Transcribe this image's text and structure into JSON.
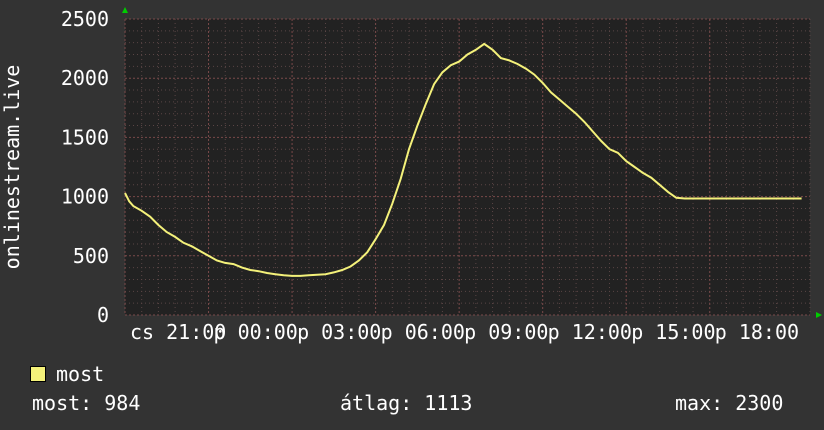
{
  "colors": {
    "background": "#333333",
    "plot": "#222222",
    "grid": "#5a4545",
    "line": "#f4f17a",
    "axis_arrow": "#00cc00",
    "text": "#ffffff"
  },
  "legend": {
    "label": "most"
  },
  "stats": {
    "current": "most: 984",
    "average": "átlag: 1113",
    "maximum": "max: 2300"
  },
  "chart_data": {
    "type": "line",
    "ylabel": "onlinestream.live",
    "ylim": [
      0,
      2500
    ],
    "yticks": [
      0,
      500,
      1000,
      1500,
      2000,
      2500
    ],
    "xlim": [
      0,
      82
    ],
    "xticks": [
      {
        "x": 0,
        "label": "cs 21:00"
      },
      {
        "x": 10,
        "label": "p 00:00"
      },
      {
        "x": 20,
        "label": "p 03:00"
      },
      {
        "x": 30,
        "label": "p 06:00"
      },
      {
        "x": 40,
        "label": "p 09:00"
      },
      {
        "x": 50,
        "label": "p 12:00"
      },
      {
        "x": 60,
        "label": "p 15:00"
      },
      {
        "x": 70,
        "label": "p 18:00"
      }
    ],
    "grid": true,
    "series": [
      {
        "name": "most",
        "x": [
          0,
          0.5,
          1,
          2,
          3,
          4,
          5,
          6,
          7,
          8,
          9,
          10,
          11,
          12,
          13,
          14,
          15,
          16,
          17,
          18,
          19,
          20,
          21,
          22,
          23,
          24,
          25,
          26,
          27,
          28,
          29,
          30,
          31,
          32,
          33,
          34,
          35,
          36,
          37,
          38,
          39,
          40,
          41,
          42,
          43,
          44,
          45,
          46,
          47,
          48,
          49,
          50,
          51,
          52,
          53,
          54,
          55,
          56,
          57,
          58,
          59,
          60,
          61,
          62,
          63,
          64,
          65,
          66,
          67,
          68,
          69,
          70,
          71,
          72,
          73,
          74,
          75,
          76,
          77,
          78,
          79,
          80,
          81
        ],
        "values": [
          1030,
          960,
          920,
          880,
          830,
          760,
          700,
          660,
          610,
          580,
          540,
          500,
          460,
          440,
          430,
          400,
          380,
          370,
          355,
          345,
          335,
          330,
          330,
          335,
          340,
          345,
          360,
          380,
          410,
          460,
          530,
          640,
          760,
          940,
          1150,
          1400,
          1600,
          1780,
          1950,
          2050,
          2110,
          2140,
          2200,
          2240,
          2290,
          2240,
          2170,
          2150,
          2120,
          2080,
          2030,
          1960,
          1880,
          1820,
          1760,
          1700,
          1630,
          1550,
          1470,
          1400,
          1370,
          1300,
          1250,
          1200,
          1160,
          1100,
          1040,
          990,
          984,
          984,
          984,
          984,
          984,
          984,
          984,
          984,
          984,
          984,
          984,
          984,
          984,
          984,
          984
        ]
      }
    ]
  }
}
